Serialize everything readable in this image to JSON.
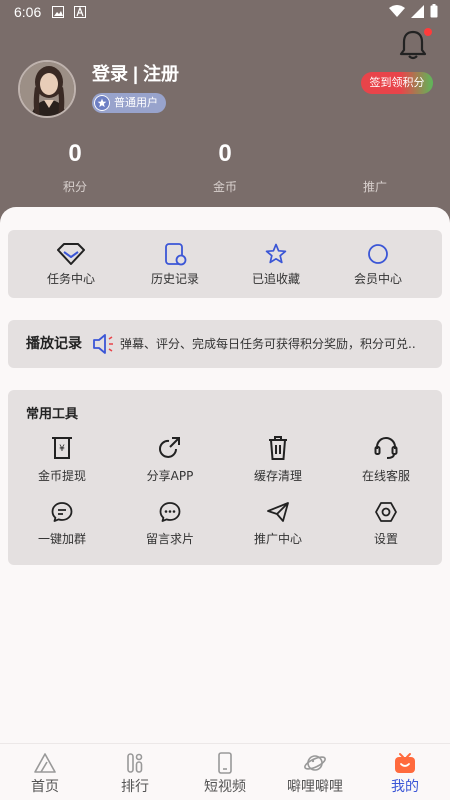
{
  "status_bar": {
    "time": "6:06"
  },
  "profile": {
    "login_text": "登录 | 注册",
    "user_level": "普通用户",
    "checkin_label": "签到领积分"
  },
  "stats": [
    {
      "value": "0",
      "label": "积分"
    },
    {
      "value": "0",
      "label": "金币"
    },
    {
      "value": "",
      "label": "推广"
    }
  ],
  "quick_links": [
    {
      "label": "任务中心",
      "icon": "diamond-icon"
    },
    {
      "label": "历史记录",
      "icon": "history-icon"
    },
    {
      "label": "已追收藏",
      "icon": "star-icon"
    },
    {
      "label": "会员中心",
      "icon": "circle-icon"
    }
  ],
  "play_history": {
    "title": "播放记录",
    "notice": "弹幕、评分、完成每日任务可获得积分奖励，积分可兑.."
  },
  "tools": {
    "title": "常用工具",
    "items": [
      {
        "label": "金币提现",
        "icon": "withdraw-icon"
      },
      {
        "label": "分享APP",
        "icon": "share-icon"
      },
      {
        "label": "缓存清理",
        "icon": "trash-icon"
      },
      {
        "label": "在线客服",
        "icon": "headset-icon"
      },
      {
        "label": "一键加群",
        "icon": "chat-group-icon"
      },
      {
        "label": "留言求片",
        "icon": "message-icon"
      },
      {
        "label": "推广中心",
        "icon": "send-icon"
      },
      {
        "label": "设置",
        "icon": "settings-icon"
      }
    ]
  },
  "tabbar": [
    {
      "label": "首页",
      "icon": "home-icon",
      "active": false
    },
    {
      "label": "排行",
      "icon": "ranking-icon",
      "active": false
    },
    {
      "label": "短视频",
      "icon": "phone-video-icon",
      "active": false
    },
    {
      "label": "噼哩噼哩",
      "icon": "planet-icon",
      "active": false
    },
    {
      "label": "我的",
      "icon": "tv-mascot-icon",
      "active": true
    }
  ],
  "colors": {
    "header_bg": "#7a6d6a",
    "accent_blue": "#3b56d6",
    "badge_bg": "#98a3cc",
    "card_bg": "#e4e0e0",
    "checkin_red": "#e8444a",
    "checkin_green": "#5db85a"
  }
}
